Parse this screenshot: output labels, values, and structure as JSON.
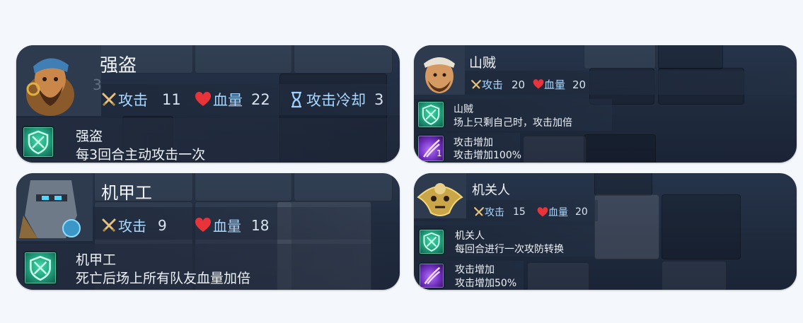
{
  "cards": {
    "qiangdao": {
      "name": "强盗",
      "attack_label": "攻击",
      "attack_value": "11",
      "hp_label": "血量",
      "hp_value": "22",
      "cooldown_label": "攻击冷却",
      "cooldown_value": "3",
      "portrait_badge": "3",
      "skill_name": "强盗",
      "skill_desc": "每3回合主动攻击一次"
    },
    "shanzei": {
      "name": "山贼",
      "attack_label": "攻击",
      "attack_value": "20",
      "hp_label": "血量",
      "hp_value": "20",
      "skill1_name": "山贼",
      "skill1_desc": "场上只剩自己时，攻击加倍",
      "skill2_name": "攻击增加",
      "skill2_desc": "攻击增加100%",
      "skill2_level": "1"
    },
    "jijiagong": {
      "name": "机甲工",
      "attack_label": "攻击",
      "attack_value": "9",
      "hp_label": "血量",
      "hp_value": "18",
      "skill_name": "机甲工",
      "skill_desc": "死亡后场上所有队友血量加倍"
    },
    "jiguanren": {
      "name": "机关人",
      "attack_label": "攻击",
      "attack_value": "15",
      "hp_label": "血量",
      "hp_value": "20",
      "skill1_name": "机关人",
      "skill1_desc": "每回合进行一次攻防转换",
      "skill2_name": "攻击增加",
      "skill2_desc": "攻击增加50%"
    }
  },
  "icons": {
    "attack": "crossed-swords-icon",
    "hp": "heart-icon",
    "cooldown": "hourglass-icon",
    "skill_green": "green-shield-skill-icon",
    "skill_purple": "purple-claw-skill-icon"
  },
  "colors": {
    "card_bg": "#1f2a3d",
    "stat_label": "#a8d8ff",
    "heart": "#e8333b",
    "sword": "#e6c27a",
    "hourglass": "#9fd0ff",
    "skill_green": "#2fc69a",
    "skill_purple": "#8a3ee0"
  }
}
